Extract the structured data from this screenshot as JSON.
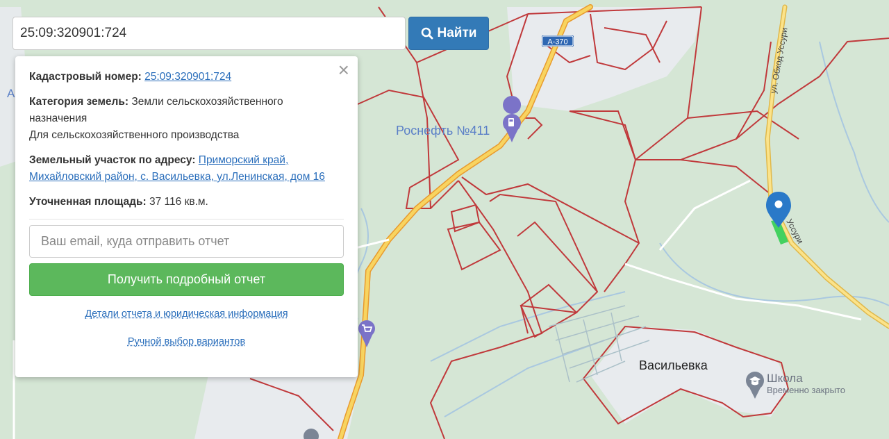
{
  "search": {
    "value": "25:09:320901:724",
    "button_label": "Найти"
  },
  "popup": {
    "cadastral_label": "Кадастровый номер:",
    "cadastral_value": "25:09:320901:724",
    "category_label": "Категория земель:",
    "category_value": "Земли сельскохозяйственного назначения",
    "use_value": "Для сельскохозяйственного производства",
    "address_label": "Земельный участок по адресу:",
    "address_value": "Приморский край, Михайловский район, с. Васильевка, ул.Ленинская, дом 16",
    "area_label": "Уточненная площадь:",
    "area_value": "37 116 кв.м.",
    "email_placeholder": "Ваш email, куда отправить отчет",
    "report_button": "Получить подробный отчет",
    "details_link": "Детали отчета и юридическая информация",
    "manual_link": "Ручной выбор вариантов",
    "close": "×"
  },
  "map": {
    "road_badge": "А-370",
    "poi_gas": "Роснефть №411",
    "village": "Васильевка",
    "school_name": "Школа",
    "school_status": "Временно закрыто",
    "street_label_1": "ул. Обход Уссури",
    "street_label_2": "Уссури",
    "edge_letter": "А",
    "colors": {
      "background": "#d6e7d6",
      "parcel_border": "#c0393b",
      "road": "#f5c542",
      "marker": "#2a79c8",
      "settlement": "#e8ebee"
    }
  }
}
